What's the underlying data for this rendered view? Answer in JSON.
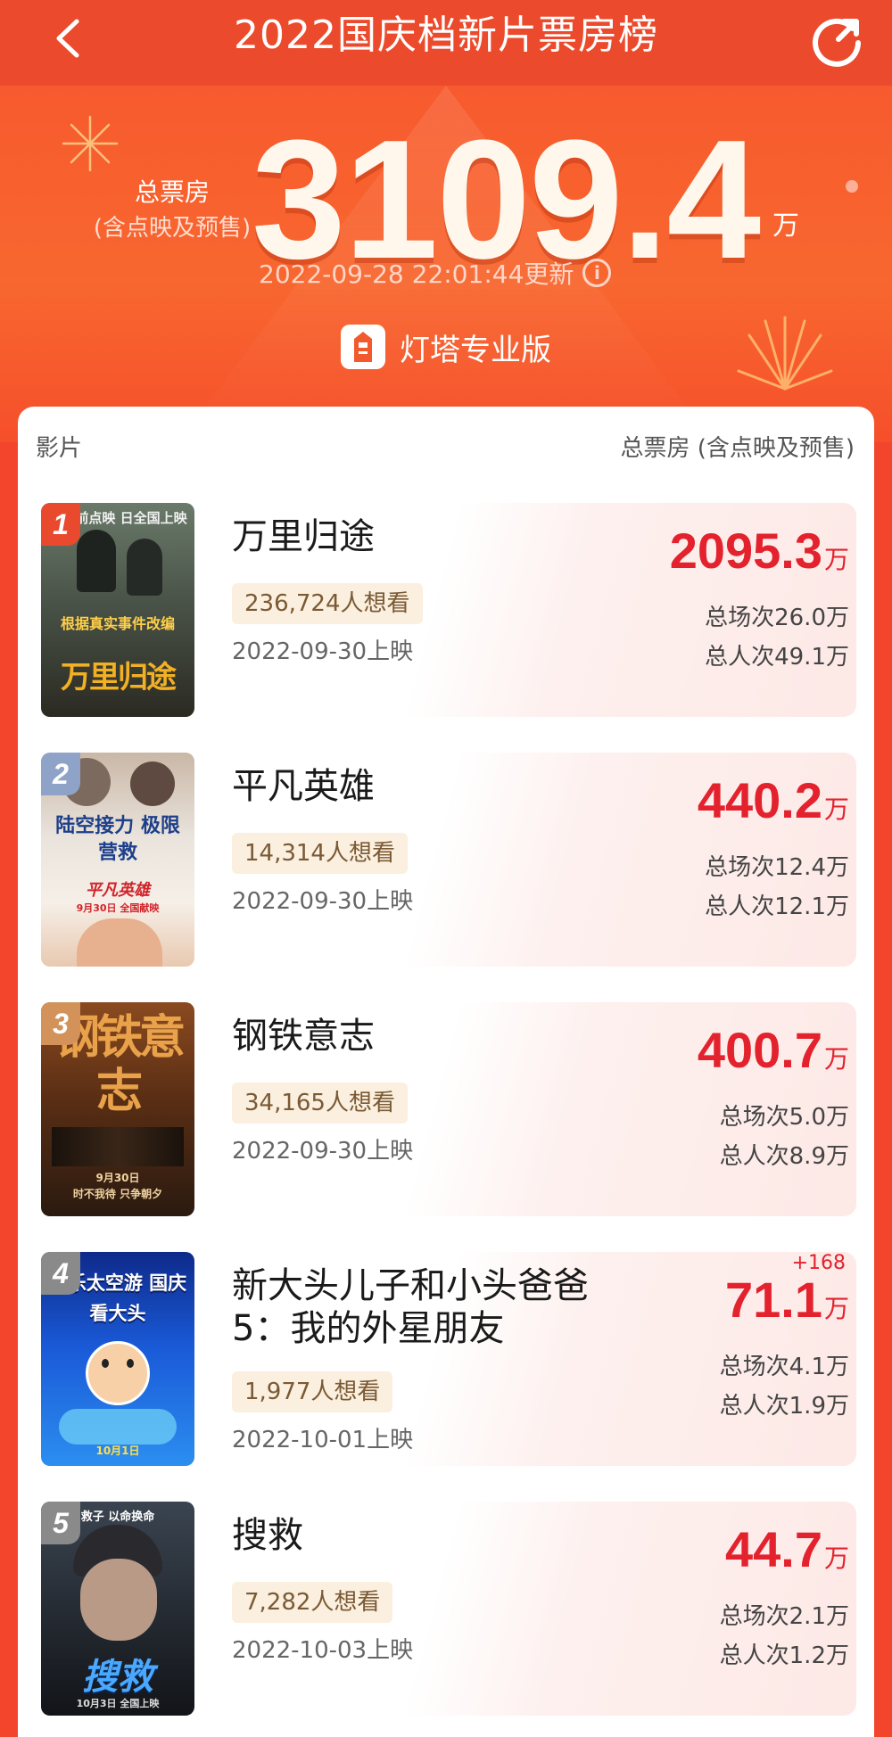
{
  "header": {
    "title": "2022国庆档新片票房榜"
  },
  "summary": {
    "total_label": "总票房",
    "total_sublabel": "(含点映及预售)",
    "total_value": "3109.4",
    "total_unit": "万",
    "update_time": "2022-09-28 22:01:44更新",
    "brand": "灯塔专业版"
  },
  "table": {
    "col_film": "影片",
    "col_box": "总票房 (含点映及预售)"
  },
  "colors": {
    "header_bg": "#ec4a2c",
    "box_red": "#e3222d",
    "rank1": "#e9492d",
    "rank2": "#8fa3c8",
    "rank3": "#d2925a",
    "rank_other": "#8a8a8a"
  },
  "movies": [
    {
      "rank": "1",
      "name": "万里归途",
      "want": "236,724人想看",
      "release": "2022-09-30上映",
      "box": "2095.3",
      "unit": "万",
      "delta": "",
      "sessions": "总场次26.0万",
      "viewers": "总人次49.1万",
      "poster_text": "万里归途",
      "poster_tag": "根据真实事件改编",
      "poster_top": "日超前点映 日全国上映"
    },
    {
      "rank": "2",
      "name": "平凡英雄",
      "want": "14,314人想看",
      "release": "2022-09-30上映",
      "box": "440.2",
      "unit": "万",
      "delta": "",
      "sessions": "总场次12.4万",
      "viewers": "总人次12.1万",
      "poster_text": "陆空接力 极限营救",
      "poster_tag": "平凡英雄",
      "poster_top": "9月30日 全国献映"
    },
    {
      "rank": "3",
      "name": "钢铁意志",
      "want": "34,165人想看",
      "release": "2022-09-30上映",
      "box": "400.7",
      "unit": "万",
      "delta": "",
      "sessions": "总场次5.0万",
      "viewers": "总人次8.9万",
      "poster_text": "钢铁意志",
      "poster_tag": "时不我待 只争朝夕",
      "poster_top": "9月30日"
    },
    {
      "rank": "4",
      "name": "新大头儿子和小头爸爸5：我的外星朋友",
      "want": "1,977人想看",
      "release": "2022-10-01上映",
      "box": "71.1",
      "unit": "万",
      "delta": "+168",
      "sessions": "总场次4.1万",
      "viewers": "总人次1.9万",
      "poster_text": "欢乐太空游 国庆看大头",
      "poster_tag": "10月1日",
      "poster_top": ""
    },
    {
      "rank": "5",
      "name": "搜救",
      "want": "7,282人想看",
      "release": "2022-10-03上映",
      "box": "44.7",
      "unit": "万",
      "delta": "",
      "sessions": "总场次2.1万",
      "viewers": "总人次1.2万",
      "poster_text": "搜救",
      "poster_tag": "救子 以命换命",
      "poster_top": "10月3日 全国上映"
    }
  ]
}
